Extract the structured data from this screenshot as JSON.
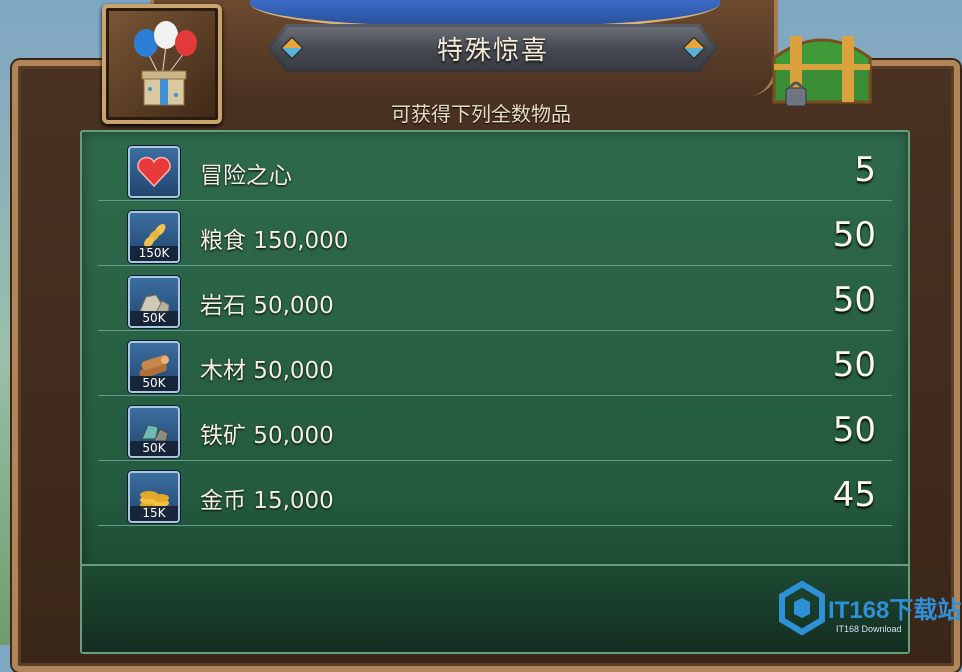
{
  "header": {
    "title": "特殊惊喜",
    "subtitle": "可获得下列全数物品"
  },
  "items": [
    {
      "icon": "heart-icon",
      "name": "冒险之心",
      "amount_badge": "",
      "qty": "5"
    },
    {
      "icon": "wheat-icon",
      "name": "粮食 150,000",
      "amount_badge": "150K",
      "qty": "50"
    },
    {
      "icon": "stone-icon",
      "name": "岩石 50,000",
      "amount_badge": "50K",
      "qty": "50"
    },
    {
      "icon": "wood-icon",
      "name": "木材 50,000",
      "amount_badge": "50K",
      "qty": "50"
    },
    {
      "icon": "ore-icon",
      "name": "铁矿 50,000",
      "amount_badge": "50K",
      "qty": "50"
    },
    {
      "icon": "gold-coin-icon",
      "name": "金币 15,000",
      "amount_badge": "15K",
      "qty": "45"
    }
  ],
  "watermark": {
    "text": "IT168下载站",
    "sub": "IT168 Download"
  },
  "colors": {
    "panel": "#2f6a4c",
    "frame": "#b0855a",
    "title_text": "#f3ead7"
  }
}
